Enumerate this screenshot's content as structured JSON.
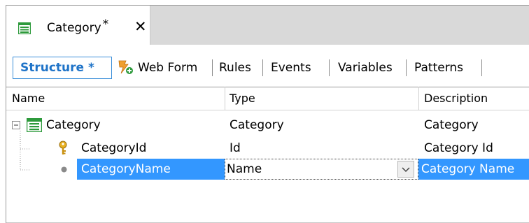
{
  "document_tab": {
    "label": "Category",
    "modified_marker": "*",
    "close_glyph": "✕"
  },
  "sub_tabs": [
    {
      "label": "Structure *"
    },
    {
      "label": "Web Form"
    },
    {
      "label": "Rules"
    },
    {
      "label": "Events"
    },
    {
      "label": "Variables"
    },
    {
      "label": "Patterns"
    }
  ],
  "grid": {
    "columns": [
      "Name",
      "Type",
      "Description"
    ],
    "rows": [
      {
        "name": "Category",
        "type": "Category",
        "description": "Category"
      },
      {
        "name": "CategoryId",
        "type": "Id",
        "description": "Category Id"
      },
      {
        "name": "CategoryName",
        "type": "Name",
        "description": "Category Name"
      }
    ]
  },
  "colors": {
    "accent": "#1e73c8",
    "selection": "#3397ff",
    "icon_green": "#2e9a3c"
  }
}
